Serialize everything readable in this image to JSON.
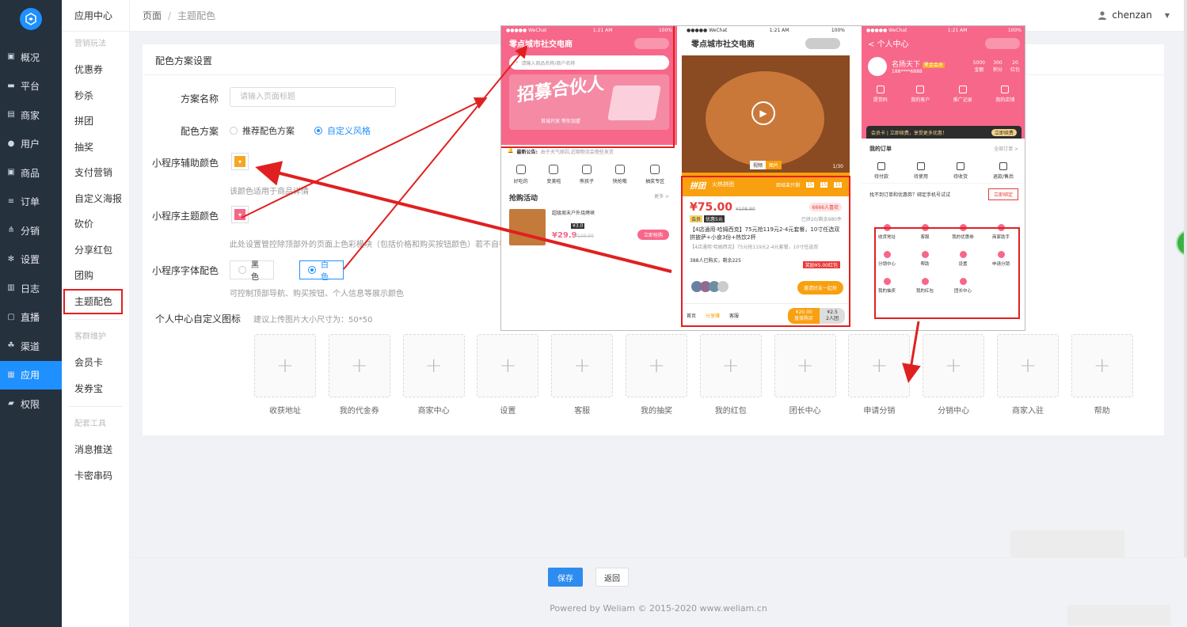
{
  "sidebar": {
    "items": [
      {
        "label": "概况",
        "icon": "dashboard-icon"
      },
      {
        "label": "平台",
        "icon": "monitor-icon"
      },
      {
        "label": "商家",
        "icon": "store-icon"
      },
      {
        "label": "用户",
        "icon": "user-icon"
      },
      {
        "label": "商品",
        "icon": "goods-icon"
      },
      {
        "label": "订单",
        "icon": "order-icon"
      },
      {
        "label": "分销",
        "icon": "distribution-icon"
      },
      {
        "label": "设置",
        "icon": "gear-icon"
      },
      {
        "label": "日志",
        "icon": "log-icon"
      },
      {
        "label": "直播",
        "icon": "live-icon"
      },
      {
        "label": "渠道",
        "icon": "channel-icon"
      },
      {
        "label": "应用",
        "icon": "apps-icon"
      },
      {
        "label": "权限",
        "icon": "lock-icon"
      }
    ],
    "active_index": 11,
    "accent": "#1e90ff"
  },
  "subnav": {
    "title": "应用中心",
    "group1": "营销玩法",
    "items1": [
      "优惠券",
      "秒杀",
      "拼团",
      "抽奖",
      "支付营销",
      "自定义海报",
      "砍价",
      "分享红包",
      "团购",
      "主题配色"
    ],
    "group2": "客群维护",
    "items2": [
      "会员卡",
      "发券宝"
    ],
    "group3": "配套工具",
    "items3": [
      "消息推送",
      "卡密串码"
    ]
  },
  "topbar": {
    "crumb1": "页面",
    "crumb2": "主题配色",
    "user": "chenzan"
  },
  "form": {
    "title": "配色方案设置",
    "name_label": "方案名称",
    "name_placeholder": "请输入页面标题",
    "scheme_label": "配色方案",
    "scheme_opt1": "推荐配色方案",
    "scheme_opt2": "自定义风格",
    "aux_label": "小程序辅助颜色",
    "aux_color": "#f5a623",
    "aux_hint": "该颜色适用于商品详情",
    "main_label": "小程序主题颜色",
    "main_color": "#f7678a",
    "main_hint": "此处设置管控除顶部外的页面上色彩模块（包括价格和购买按钮颜色）若不自行选",
    "font_label": "小程序字体配色",
    "font_black": "黑色",
    "font_white": "白色",
    "font_hint": "可控制顶部导航、购买按钮、个人信息等展示颜色",
    "icons_label": "个人中心自定义图标",
    "icons_hint": "建议上传图片大小尺寸为：50*50",
    "icons": [
      "收获地址",
      "我的代金券",
      "商家中心",
      "设置",
      "客服",
      "我的抽奖",
      "我的红包",
      "团长中心",
      "申请分销",
      "分销中心",
      "商家入驻",
      "帮助"
    ]
  },
  "buttons": {
    "save": "保存",
    "back": "返回"
  },
  "copyright": "Powered by Weliam © 2015-2020 www.weliam.cn",
  "preview": {
    "p1": {
      "status_left": "●●●●● WeChat",
      "status_time": "1:21 AM",
      "status_right": "100%",
      "title": "零点城市社交电商",
      "search": "请输入商品名称/商户名称",
      "banner_big": "招募合伙人",
      "banner_small": "首城开放 等你加盟",
      "notice_label": "最新公告:",
      "notice": "由于天气原因,近期物流会慢些发货",
      "cats": [
        "好吃的",
        "变美啦",
        "熊孩子",
        "快抢哦",
        "抽奖专区"
      ],
      "section": "抢购活动",
      "more": "更多 >",
      "item_title": "超级周末户外烧烤峡",
      "item_price": "¥29.9",
      "item_old": "¥129.00",
      "item_tag": "¥3.0",
      "item_btn": "立即抢购"
    },
    "p2": {
      "status_left": "●●●●● WeChat",
      "status_time": "1:21 AM",
      "status_right": "100%",
      "title": "零点城市社交电商",
      "page": "1/30",
      "tabs": [
        "视频",
        "图片"
      ],
      "bar_logo": "拼团",
      "bar_text": "火热拼团",
      "countdown_label": "距结束只剩",
      "countdown": [
        "15",
        "15",
        "15"
      ],
      "price": "¥75.00",
      "old_price": "¥108.80",
      "likes": "6666人喜欢",
      "tag1": "会员",
      "tag2": "优惠5元",
      "sold": "已拼20/剩余980件",
      "product": "【4店通用·哈姆西克】75元抢119元2-4元套餐，10寸任选双拼披萨+小食3份+热饮2杯",
      "product_sub": "【4店通用·哈姆西克】75元抢119元2-4元套餐，10寸任选双",
      "group_count": "388人已购买，剩余225",
      "reward": "奖励¥5.00红包",
      "invite": "邀请好友一起抢",
      "nav": [
        "首页",
        "分享赚",
        "客服"
      ],
      "buy_price": "¥20.00",
      "buy_label": "直接购买",
      "group_price": "¥2.5",
      "group_label": "2人团"
    },
    "p3": {
      "status_left": "●●●●● WeChat",
      "status_time": "1:21 AM",
      "status_right": "100%",
      "title": "个人中心",
      "name": "名扬天下",
      "vip": "黑金会员",
      "phone": "188****6888",
      "stats": [
        {
          "v": "5000",
          "l": "金额"
        },
        {
          "v": "300",
          "l": "积分"
        },
        {
          "v": "20",
          "l": "红包"
        }
      ],
      "actions": [
        "提货码",
        "我的客户",
        "推广记录",
        "我的店铺"
      ],
      "vip_bar": "会员卡 | 立即续费，享受更多优惠！",
      "vip_btn": "立即续费",
      "orders_title": "我的订单",
      "orders_all": "全部订单 >",
      "orders": [
        "待付款",
        "待使用",
        "待收货",
        "退款/售后"
      ],
      "bind_text": "找不到订单和优惠券？绑定手机号试试",
      "bind_btn": "立即绑定",
      "grid": [
        "收货地址",
        "客服",
        "我的优惠券",
        "商家助手",
        "分销中心",
        "帮助",
        "设置",
        "申请分销",
        "我的抽奖",
        "我的红包",
        "团长中心"
      ]
    }
  }
}
